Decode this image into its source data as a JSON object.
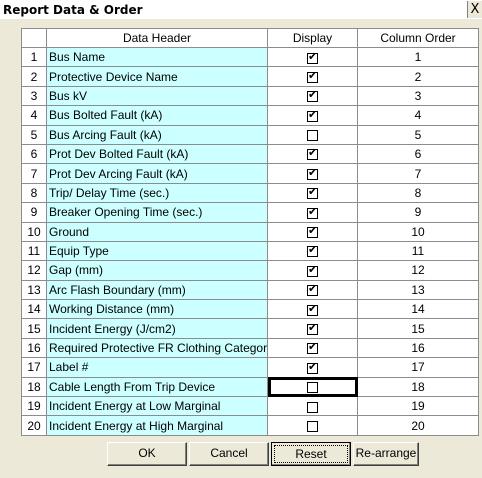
{
  "window": {
    "title": "Report Data & Order",
    "close_glyph": "X"
  },
  "table": {
    "headers": {
      "data_header": "Data Header",
      "display": "Display",
      "column_order": "Column Order"
    },
    "rows": [
      {
        "num": "1",
        "name": "Bus Name",
        "display": true,
        "order": "1"
      },
      {
        "num": "2",
        "name": "Protective Device Name",
        "display": true,
        "order": "2"
      },
      {
        "num": "3",
        "name": "Bus kV",
        "display": true,
        "order": "3"
      },
      {
        "num": "4",
        "name": "Bus Bolted Fault (kA)",
        "display": true,
        "order": "4"
      },
      {
        "num": "5",
        "name": "Bus Arcing Fault (kA)",
        "display": false,
        "order": "5"
      },
      {
        "num": "6",
        "name": "Prot Dev Bolted Fault   (kA)",
        "display": true,
        "order": "6"
      },
      {
        "num": "7",
        "name": "Prot Dev Arcing Fault (kA)",
        "display": true,
        "order": "7"
      },
      {
        "num": "8",
        "name": "Trip/ Delay Time (sec.)",
        "display": true,
        "order": "8"
      },
      {
        "num": "9",
        "name": "Breaker Opening Time (sec.)",
        "display": true,
        "order": "9"
      },
      {
        "num": "10",
        "name": "Ground",
        "display": true,
        "order": "10"
      },
      {
        "num": "11",
        "name": "Equip Type",
        "display": true,
        "order": "11"
      },
      {
        "num": "12",
        "name": "Gap (mm)",
        "display": true,
        "order": "12"
      },
      {
        "num": "13",
        "name": "Arc Flash Boundary (mm)",
        "display": true,
        "order": "13"
      },
      {
        "num": "14",
        "name": "Working Distance (mm)",
        "display": true,
        "order": "14"
      },
      {
        "num": "15",
        "name": "Incident Energy (J/cm2)",
        "display": true,
        "order": "15"
      },
      {
        "num": "16",
        "name": "Required Protective FR Clothing Category",
        "display": true,
        "order": "16"
      },
      {
        "num": "17",
        "name": "Label #",
        "display": true,
        "order": "17"
      },
      {
        "num": "18",
        "name": "Cable Length From Trip Device",
        "display": false,
        "order": "18",
        "focused": true
      },
      {
        "num": "19",
        "name": "Incident Energy at Low Marginal",
        "display": false,
        "order": "19"
      },
      {
        "num": "20",
        "name": "Incident Energy at High Marginal",
        "display": false,
        "order": "20"
      }
    ]
  },
  "buttons": {
    "ok": "OK",
    "cancel": "Cancel",
    "reset": "Reset",
    "rearrange": "Re-arrange"
  }
}
